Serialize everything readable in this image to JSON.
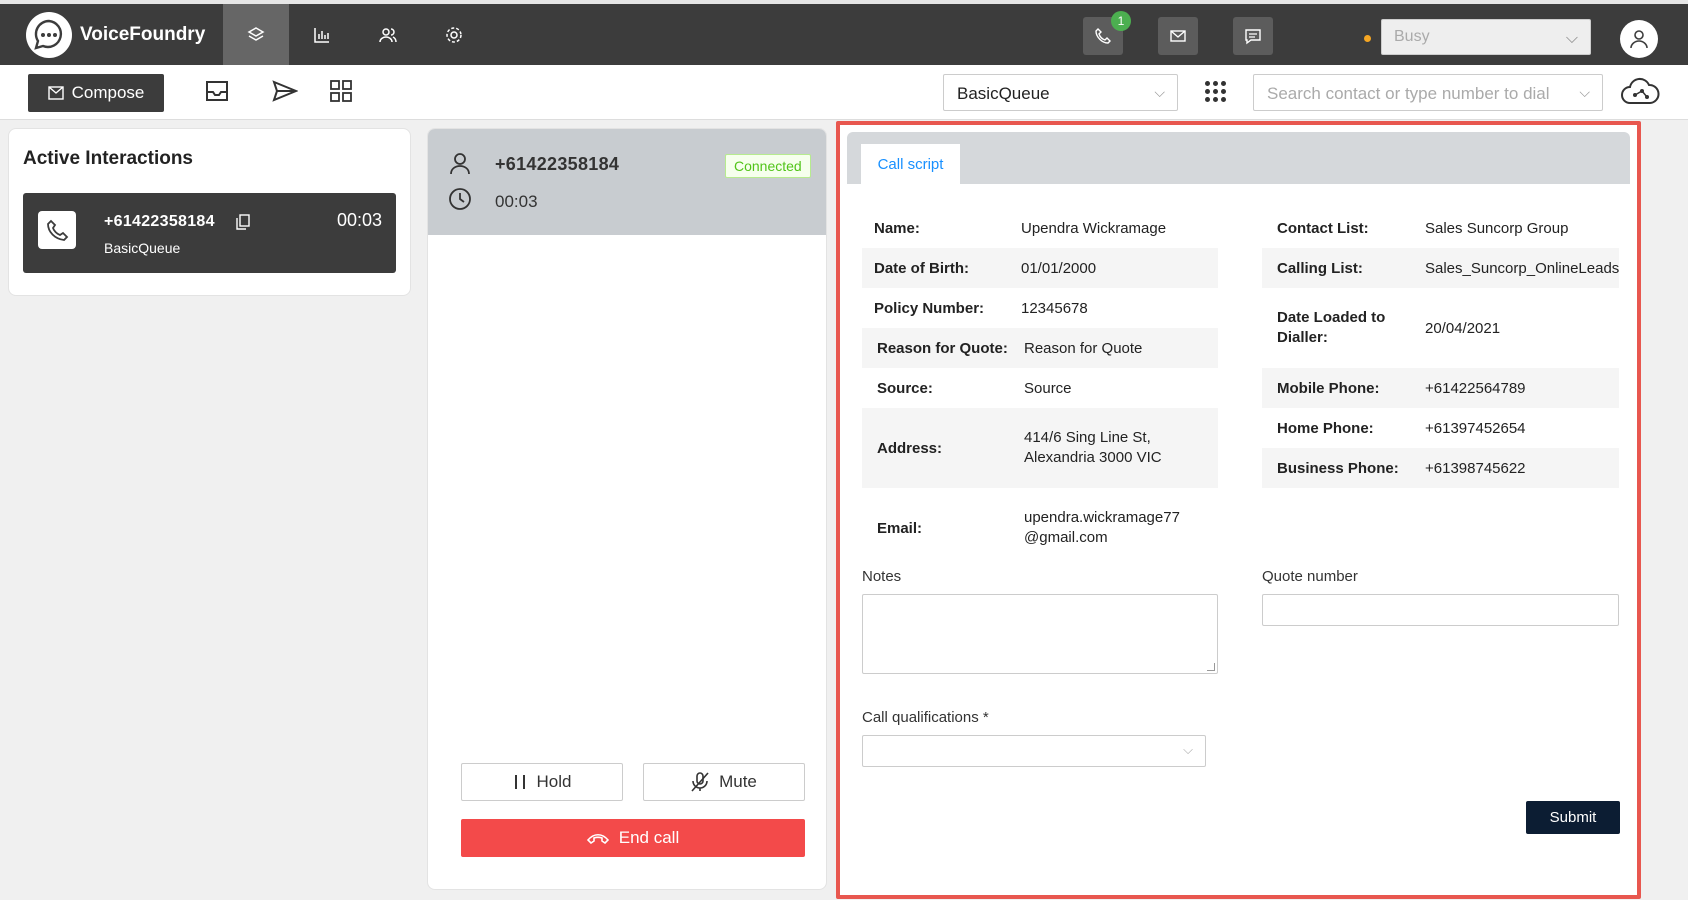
{
  "app": {
    "name": "VoiceFoundry"
  },
  "topbar": {
    "phone_badge": "1",
    "status": {
      "value": "Busy"
    }
  },
  "toolbar": {
    "compose_label": "Compose",
    "queue": "BasicQueue",
    "search_placeholder": "Search contact or type number to dial"
  },
  "active_interactions": {
    "title": "Active Interactions",
    "items": [
      {
        "number": "+61422358184",
        "queue": "BasicQueue",
        "timer": "00:03"
      }
    ]
  },
  "call": {
    "number": "+61422358184",
    "duration": "00:03",
    "status": "Connected",
    "hold_label": "Hold",
    "mute_label": "Mute",
    "end_label": "End call"
  },
  "script": {
    "tab": "Call script",
    "left_fields": [
      {
        "label": "Name:",
        "value": "Upendra Wickramage"
      },
      {
        "label": "Date of Birth:",
        "value": "01/01/2000"
      },
      {
        "label": "Policy Number:",
        "value": "12345678"
      },
      {
        "label": "Reason for Quote:",
        "value": "Reason for Quote"
      },
      {
        "label": "Source:",
        "value": "Source"
      },
      {
        "label": "Address:",
        "value": "414/6 Sing Line St, Alexandria 3000 VIC"
      },
      {
        "label": "Email:",
        "value": "upendra.wickramage77@gmail.com"
      }
    ],
    "right_fields": [
      {
        "label": "Contact List:",
        "value": "Sales Suncorp Group"
      },
      {
        "label": "Calling List:",
        "value": "Sales_Suncorp_OnlineLeads"
      },
      {
        "label": "Date Loaded to Dialler:",
        "value": "20/04/2021"
      },
      {
        "label": "Mobile Phone:",
        "value": "+61422564789"
      },
      {
        "label": "Home Phone:",
        "value": "+61397452654"
      },
      {
        "label": "Business Phone:",
        "value": "+61398745622"
      }
    ],
    "notes_label": "Notes",
    "quote_number_label": "Quote number",
    "qualifications_label": "Call qualifications *",
    "submit_label": "Submit"
  }
}
